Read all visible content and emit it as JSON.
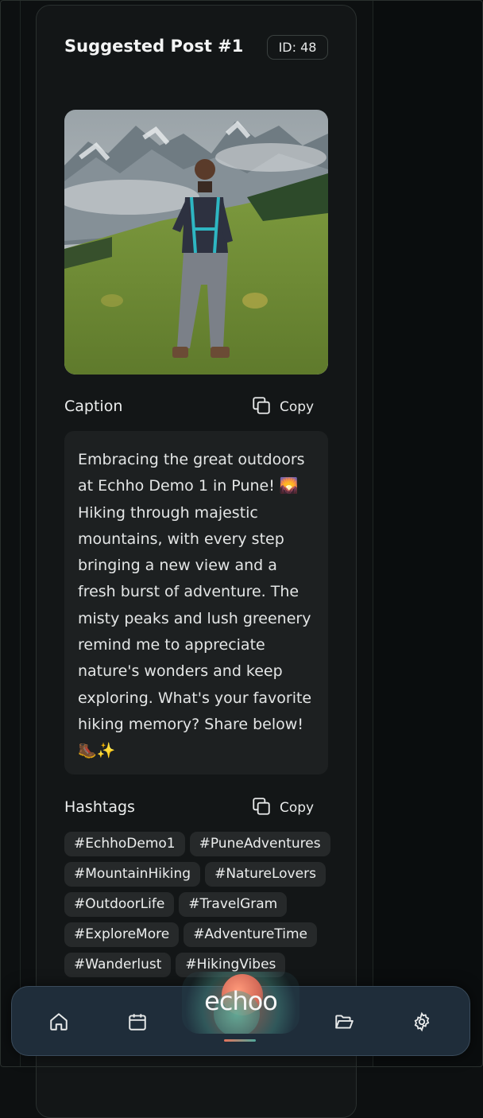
{
  "post": {
    "title": "Suggested Post #1",
    "id_label": "ID: 48"
  },
  "caption": {
    "heading": "Caption",
    "copy_label": "Copy",
    "text": "Embracing the great outdoors at Echho Demo 1 in Pune! 🌄 Hiking through majestic mountains, with every step bringing a new view and a fresh burst of adventure. The misty peaks and lush greenery remind me to appreciate nature's wonders and keep exploring. What's your favorite hiking memory? Share below! 🥾✨"
  },
  "hashtags": {
    "heading": "Hashtags",
    "copy_label": "Copy",
    "items": [
      "#EchhoDemo1",
      "#PuneAdventures",
      "#MountainHiking",
      "#NatureLovers",
      "#OutdoorLife",
      "#TravelGram",
      "#ExploreMore",
      "#AdventureTime",
      "#Wanderlust",
      "#HikingVibes"
    ]
  },
  "nav": {
    "logo_text": "echoo",
    "items": [
      {
        "name": "home",
        "icon": "home-icon"
      },
      {
        "name": "calendar",
        "icon": "calendar-icon"
      },
      {
        "name": "logo",
        "icon": "echoo-logo"
      },
      {
        "name": "folder",
        "icon": "folder-open-icon"
      },
      {
        "name": "settings",
        "icon": "gear-icon"
      }
    ]
  },
  "colors": {
    "background": "#0d1011",
    "card": "#131617",
    "nav_bar": "#1f2d3a",
    "accent_coral": "#e5735c",
    "accent_teal": "#4fa89a"
  }
}
